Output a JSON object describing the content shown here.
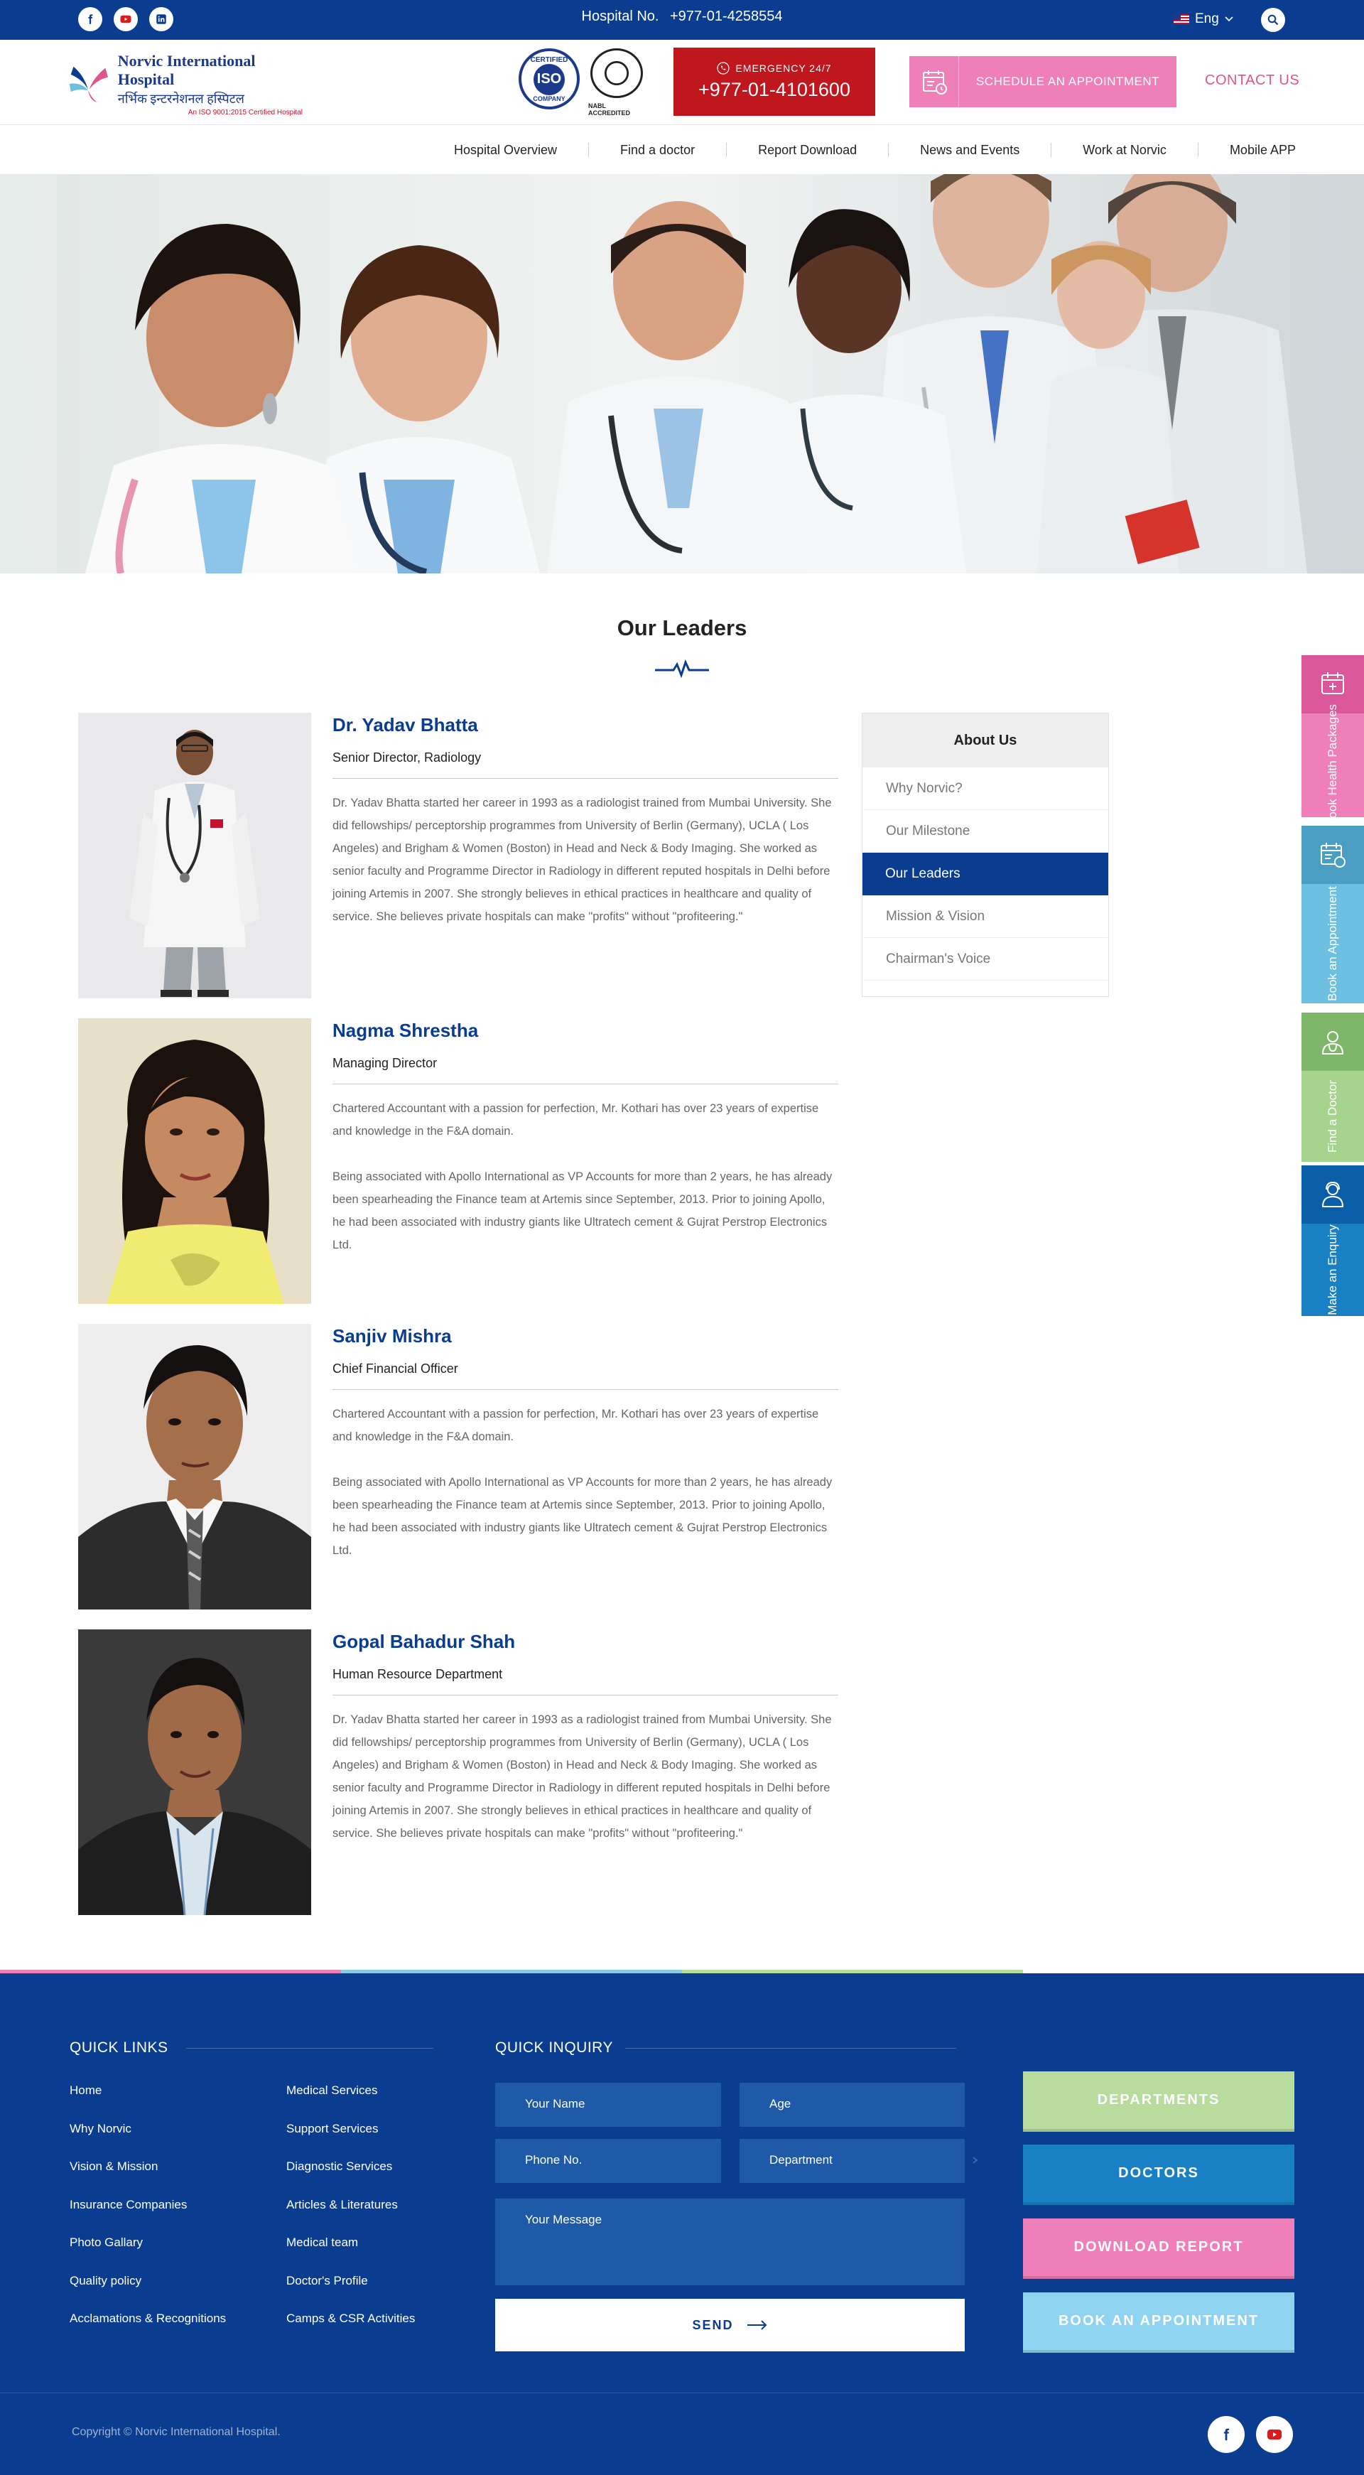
{
  "topbar": {
    "social": [
      "facebook-icon",
      "youtube-icon",
      "linkedin-icon"
    ],
    "hospital_label": "Hospital No.",
    "hospital_number": "+977-01-4258554",
    "language": "Eng",
    "bg_color": "#0a3d8f"
  },
  "header": {
    "logo_name": "Norvic International Hospital",
    "logo_name_nepali": "नर्भिक इन्टरनेशनल हस्पिटल",
    "logo_tagline": "An ISO 9001:2015 Certified Hospital",
    "cert_iso_top": "CERTIFIED",
    "cert_iso_mid": "ISO",
    "cert_iso_bottom": "COMPANY",
    "cert_nabl": "NABL ACCREDITED",
    "emergency_label": "EMERGENCY 24/7",
    "emergency_number": "+977-01-4101600",
    "schedule_label": "SCHEDULE AN APPOINTMENT",
    "contact_label": "CONTACT US",
    "emergency_color": "#c0171e",
    "schedule_color": "#ee7fb8"
  },
  "nav": {
    "items": [
      "Hospital Overview",
      "Find a doctor",
      "Report Download",
      "News and Events",
      "Work at Norvic",
      "Mobile APP"
    ]
  },
  "page": {
    "title": "Our Leaders"
  },
  "leaders": [
    {
      "name": "Dr. Yadav Bhatta",
      "role": "Senior Director, Radiology",
      "bio": [
        "Dr. Yadav Bhatta started her career in 1993 as a radiologist trained from Mumbai University. She did fellowships/ perceptorship programmes from University of Berlin (Germany), UCLA ( Los Angeles) and Brigham & Women (Boston) in Head and Neck & Body Imaging. She worked as senior faculty and Programme Director in Radiology in different reputed hospitals in Delhi before joining Artemis in 2007. She strongly believes in ethical practices in healthcare and quality of service. She believes private hospitals can make \"profits\" without \"profiteering.\""
      ]
    },
    {
      "name": "Nagma Shrestha",
      "role": "Managing Director",
      "bio": [
        "Chartered Accountant with a passion for perfection, Mr. Kothari has over 23 years of expertise and knowledge in the F&A domain.",
        "Being associated with Apollo International as VP Accounts for more than 2 years, he has already been spearheading the Finance team at Artemis since September, 2013. Prior to joining Apollo, he had been associated with industry giants like Ultratech cement & Gujrat Perstrop Electronics Ltd."
      ]
    },
    {
      "name": "Sanjiv Mishra",
      "role": "Chief Financial Officer",
      "bio": [
        "Chartered Accountant with a passion for perfection, Mr. Kothari has over 23 years of expertise and knowledge in the F&A domain.",
        "Being associated with Apollo International as VP Accounts for more than 2 years, he has already been spearheading the Finance team at Artemis since September, 2013. Prior to joining Apollo, he had been associated with industry giants like Ultratech cement & Gujrat Perstrop Electronics Ltd."
      ]
    },
    {
      "name": "Gopal Bahadur Shah",
      "role": "Human Resource Department",
      "bio": [
        "Dr. Yadav Bhatta started her career in 1993 as a radiologist trained from Mumbai University. She did fellowships/ perceptorship programmes from University of Berlin (Germany), UCLA ( Los Angeles) and Brigham & Women (Boston) in Head and Neck & Body Imaging. She worked as senior faculty and Programme Director in Radiology in different reputed hospitals in Delhi before joining Artemis in 2007. She strongly believes in ethical practices in healthcare and quality of service. She believes private hospitals can make \"profits\" without \"profiteering.\""
      ]
    }
  ],
  "sidebar": {
    "title": "About Us",
    "items": [
      "Why Norvic?",
      "Our Milestone",
      "Our Leaders",
      "Mission & Vision",
      "Chairman's Voice"
    ],
    "active": "Our Leaders"
  },
  "side_tabs": [
    {
      "label": "Book Health Packages",
      "icon": "health-package-icon",
      "icon_color": "#d9579a",
      "label_color": "#ee7fb8"
    },
    {
      "label": "Book an Appointment",
      "icon": "calendar-icon",
      "icon_color": "#4a9ec4",
      "label_color": "#6cc0e2"
    },
    {
      "label": "Find a Doctor",
      "icon": "doctor-icon",
      "icon_color": "#7fb76a",
      "label_color": "#a6d48e"
    },
    {
      "label": "Make an Enquiry",
      "icon": "enquiry-icon",
      "icon_color": "#0a5ea8",
      "label_color": "#1a80c4"
    }
  ],
  "footer": {
    "quick_links_title": "QUICK LINKS",
    "links_col1": [
      "Home",
      "Why Norvic",
      "Vision & Mission",
      "Insurance Companies",
      "Photo Gallary",
      "Quality policy",
      "Acclamations & Recognitions"
    ],
    "links_col2": [
      "Medical Services",
      "Support Services",
      "Diagnostic Services",
      "Articles & Literatures",
      "Medical team",
      "Doctor's Profile",
      "Camps & CSR Activities"
    ],
    "inquiry_title": "QUICK INQUIRY",
    "form": {
      "name": "Your Name",
      "age": "Age",
      "phone": "Phone No.",
      "department": "Department",
      "message": "Your Message",
      "send": "SEND"
    },
    "buttons": [
      {
        "label": "DEPARTMENTS",
        "color": "#b7dc9e"
      },
      {
        "label": "DOCTORS",
        "color": "#1a80c4"
      },
      {
        "label": "DOWNLOAD REPORT",
        "color": "#ee7fb8"
      },
      {
        "label": "BOOK AN APPOINTMENT",
        "color": "#8ed3f0"
      }
    ],
    "copyright": "Copyright © Norvic International Hospital.",
    "social": [
      "facebook-icon",
      "youtube-icon"
    ],
    "bg_color": "#0a3d8f"
  }
}
